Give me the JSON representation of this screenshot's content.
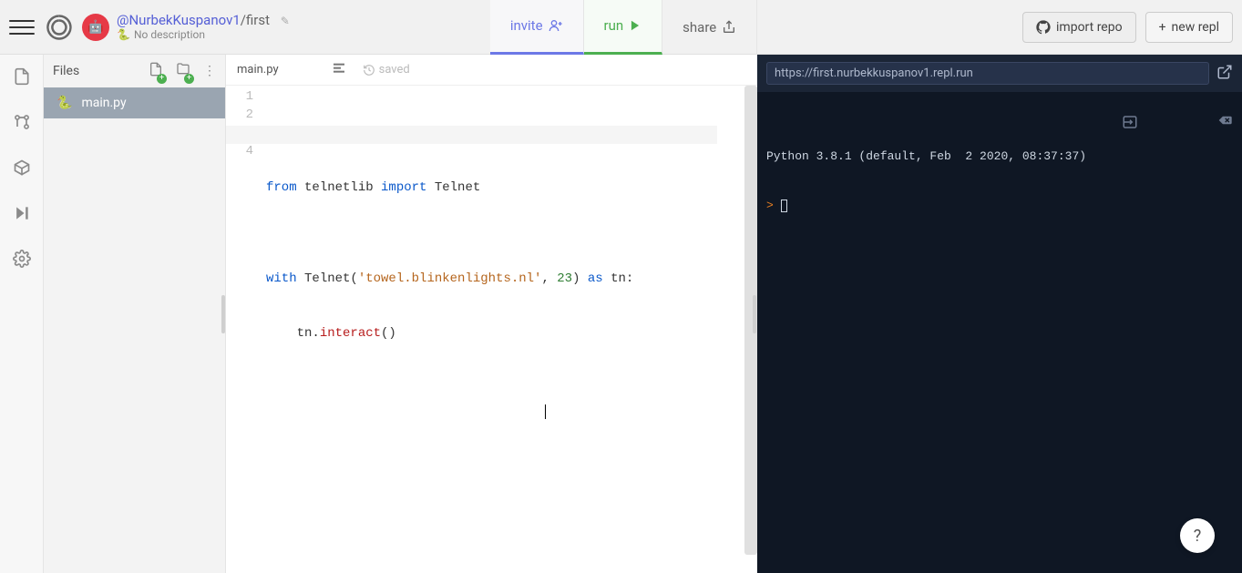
{
  "header": {
    "user": "@NurbekKuspanov1",
    "separator": "/",
    "project": "first",
    "description": "No description",
    "invite_label": "invite",
    "run_label": "run",
    "share_label": "share",
    "import_repo_label": "import repo",
    "new_repl_label": "new repl"
  },
  "files": {
    "pane_title": "Files",
    "items": [
      {
        "name": "main.py"
      }
    ]
  },
  "editor": {
    "tab": "main.py",
    "saved_label": "saved",
    "lines": {
      "l1a": "from",
      "l1b": " telnetlib ",
      "l1c": "import",
      "l1d": " Telnet",
      "l2": "",
      "l3a": "with",
      "l3b": " Telnet(",
      "l3c": "'towel.blinkenlights.nl'",
      "l3d": ", ",
      "l3e": "23",
      "l3f": ") ",
      "l3g": "as",
      "l3h": " tn:",
      "l4a": "    tn.",
      "l4b": "interact",
      "l4c": "()"
    }
  },
  "console": {
    "url": "https://first.nurbekkuspanov1.repl.run",
    "banner": "Python 3.8.1 (default, Feb  2 2020, 08:37:37)",
    "prompt": ">"
  },
  "fab": {
    "label": "?"
  }
}
